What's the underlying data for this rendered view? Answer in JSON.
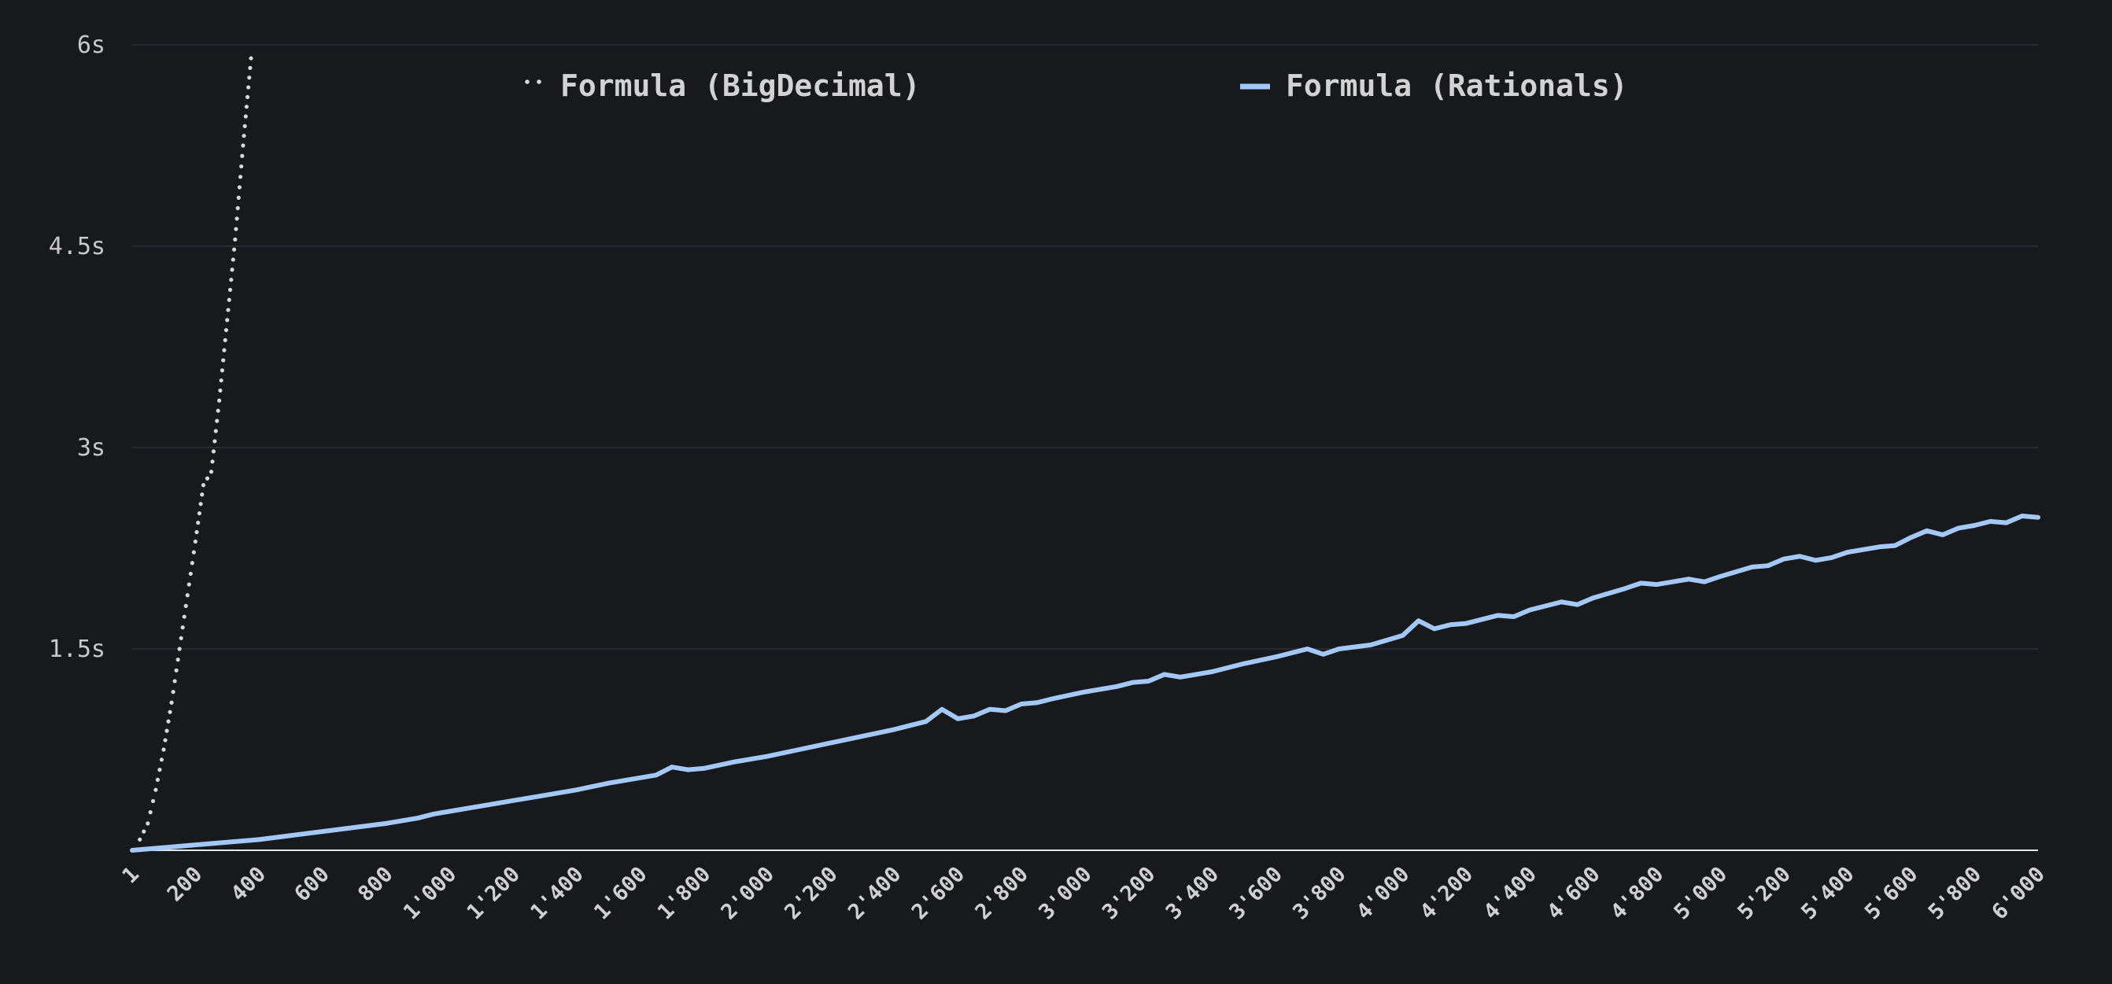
{
  "chart_data": {
    "type": "line",
    "title": "",
    "xlabel": "",
    "ylabel": "",
    "xlim": [
      1,
      6000
    ],
    "ylim": [
      0,
      6
    ],
    "grid": true,
    "legend_position": "top",
    "y_ticks": [
      {
        "value": 1.5,
        "label": "1.5s"
      },
      {
        "value": 3,
        "label": "3s"
      },
      {
        "value": 4.5,
        "label": "4.5s"
      },
      {
        "value": 6,
        "label": "6s"
      }
    ],
    "x_ticks": [
      {
        "value": 1,
        "label": "1"
      },
      {
        "value": 200,
        "label": "200"
      },
      {
        "value": 400,
        "label": "400"
      },
      {
        "value": 600,
        "label": "600"
      },
      {
        "value": 800,
        "label": "800"
      },
      {
        "value": 1000,
        "label": "1'000"
      },
      {
        "value": 1200,
        "label": "1'200"
      },
      {
        "value": 1400,
        "label": "1'400"
      },
      {
        "value": 1600,
        "label": "1'600"
      },
      {
        "value": 1800,
        "label": "1'800"
      },
      {
        "value": 2000,
        "label": "2'000"
      },
      {
        "value": 2200,
        "label": "2'200"
      },
      {
        "value": 2400,
        "label": "2'400"
      },
      {
        "value": 2600,
        "label": "2'600"
      },
      {
        "value": 2800,
        "label": "2'800"
      },
      {
        "value": 3000,
        "label": "3'000"
      },
      {
        "value": 3200,
        "label": "3'200"
      },
      {
        "value": 3400,
        "label": "3'400"
      },
      {
        "value": 3600,
        "label": "3'600"
      },
      {
        "value": 3800,
        "label": "3'800"
      },
      {
        "value": 4000,
        "label": "4'000"
      },
      {
        "value": 4200,
        "label": "4'200"
      },
      {
        "value": 4400,
        "label": "4'400"
      },
      {
        "value": 4600,
        "label": "4'600"
      },
      {
        "value": 4800,
        "label": "4'800"
      },
      {
        "value": 5000,
        "label": "5'000"
      },
      {
        "value": 5200,
        "label": "5'200"
      },
      {
        "value": 5400,
        "label": "5'400"
      },
      {
        "value": 5600,
        "label": "5'600"
      },
      {
        "value": 5800,
        "label": "5'800"
      },
      {
        "value": 6000,
        "label": "6'000"
      }
    ],
    "series": [
      {
        "name": "Formula (BigDecimal)",
        "color": "#d8d8d8",
        "style": "dotted",
        "x": [
          1,
          25,
          50,
          75,
          100,
          125,
          150,
          175,
          200,
          225,
          250,
          275,
          300,
          325,
          350,
          375
        ],
        "y": [
          0.0,
          0.08,
          0.2,
          0.45,
          0.75,
          1.1,
          1.5,
          1.9,
          2.3,
          2.72,
          2.82,
          3.35,
          3.95,
          4.55,
          5.25,
          5.9
        ]
      },
      {
        "name": "Formula (Rationals)",
        "color": "#a4c8f5",
        "style": "solid",
        "x": [
          1,
          100,
          200,
          300,
          400,
          500,
          600,
          700,
          800,
          900,
          950,
          1000,
          1100,
          1200,
          1300,
          1400,
          1500,
          1600,
          1650,
          1700,
          1750,
          1800,
          1900,
          2000,
          2100,
          2200,
          2300,
          2400,
          2500,
          2550,
          2600,
          2650,
          2700,
          2750,
          2800,
          2850,
          2900,
          3000,
          3100,
          3150,
          3200,
          3250,
          3300,
          3350,
          3400,
          3500,
          3600,
          3700,
          3750,
          3800,
          3900,
          4000,
          4050,
          4100,
          4150,
          4200,
          4300,
          4350,
          4400,
          4500,
          4550,
          4600,
          4700,
          4750,
          4800,
          4850,
          4900,
          4950,
          5000,
          5100,
          5150,
          5200,
          5250,
          5300,
          5350,
          5400,
          5500,
          5550,
          5600,
          5650,
          5700,
          5750,
          5800,
          5850,
          5900,
          5950,
          6000
        ],
        "y": [
          0.0,
          0.02,
          0.04,
          0.06,
          0.08,
          0.11,
          0.14,
          0.17,
          0.2,
          0.24,
          0.27,
          0.29,
          0.33,
          0.37,
          0.41,
          0.45,
          0.5,
          0.54,
          0.56,
          0.62,
          0.6,
          0.61,
          0.66,
          0.7,
          0.75,
          0.8,
          0.85,
          0.9,
          0.96,
          1.05,
          0.98,
          1.0,
          1.05,
          1.04,
          1.09,
          1.1,
          1.13,
          1.18,
          1.22,
          1.25,
          1.26,
          1.31,
          1.29,
          1.31,
          1.33,
          1.39,
          1.44,
          1.5,
          1.46,
          1.5,
          1.53,
          1.6,
          1.71,
          1.65,
          1.68,
          1.69,
          1.75,
          1.74,
          1.79,
          1.85,
          1.83,
          1.88,
          1.95,
          1.99,
          1.98,
          2.0,
          2.02,
          2.0,
          2.04,
          2.11,
          2.12,
          2.17,
          2.19,
          2.16,
          2.18,
          2.22,
          2.26,
          2.27,
          2.33,
          2.38,
          2.35,
          2.4,
          2.42,
          2.45,
          2.44,
          2.49,
          2.48
        ]
      }
    ]
  }
}
